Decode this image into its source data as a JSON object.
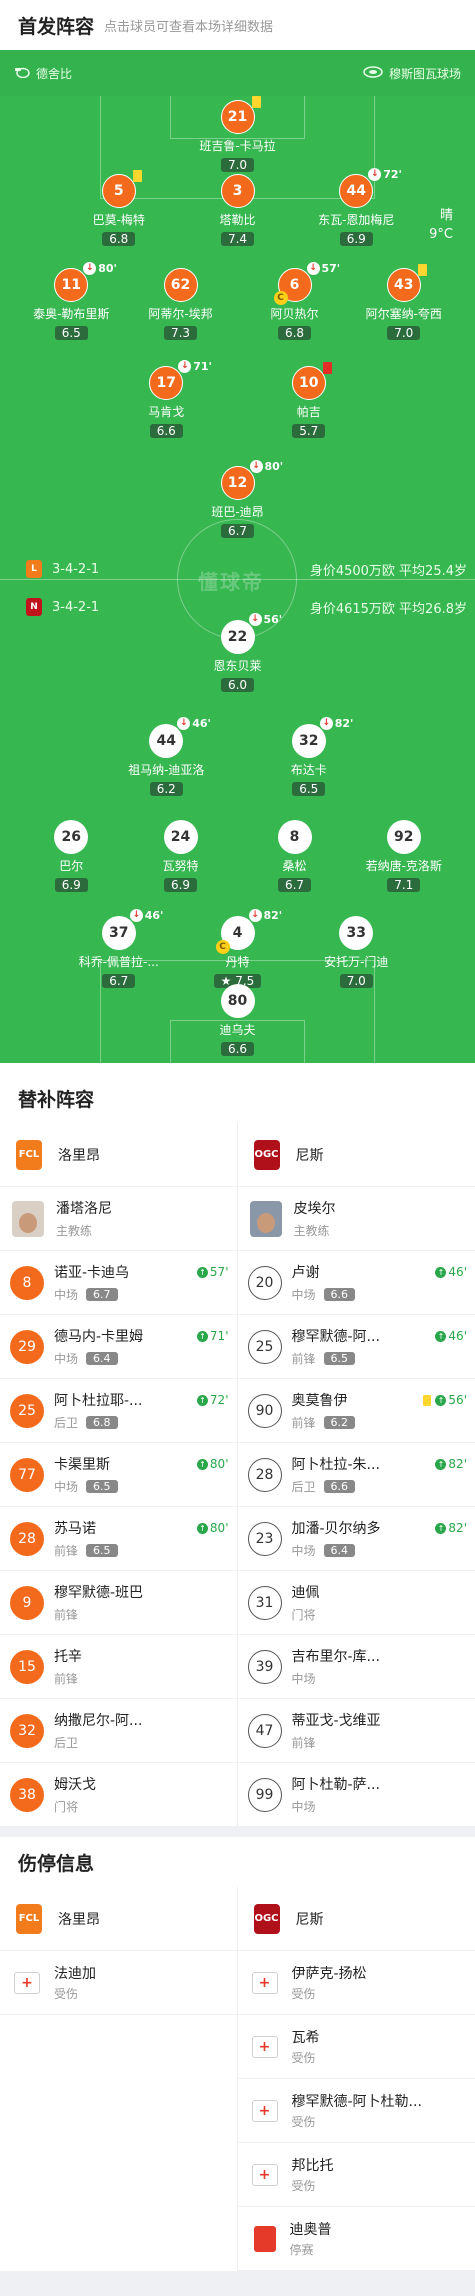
{
  "lineup_section": {
    "title": "首发阵容",
    "subtitle": "点击球员可查看本场详细数据"
  },
  "venue": {
    "home_stadium": "德舍比",
    "away_stadium": "穆斯图瓦球场"
  },
  "weather": {
    "condition": "晴",
    "temperature": "9°C"
  },
  "watermark": "懂球帝",
  "home_team": {
    "formation": "3-4-2-1",
    "value_text": "身价4500万欧 平均25.4岁"
  },
  "away_team": {
    "formation": "3-4-2-1",
    "value_text": "身价4615万欧 平均26.8岁"
  },
  "home_players": [
    {
      "num": "21",
      "name": "班吉鲁-卡马拉",
      "rating": "7.0"
    },
    {
      "num": "5",
      "name": "巴莫-梅特",
      "rating": "6.8"
    },
    {
      "num": "3",
      "name": "塔勒比",
      "rating": "7.4"
    },
    {
      "num": "44",
      "name": "东瓦-恩加梅尼",
      "rating": "6.9",
      "event": "72'"
    },
    {
      "num": "11",
      "name": "泰奥-勒布里斯",
      "rating": "6.5",
      "event": "80'"
    },
    {
      "num": "62",
      "name": "阿蒂尔-埃邦",
      "rating": "7.3"
    },
    {
      "num": "6",
      "name": "阿贝热尔",
      "rating": "6.8",
      "event": "57'"
    },
    {
      "num": "43",
      "name": "阿尔塞纳-夸西",
      "rating": "7.0"
    },
    {
      "num": "17",
      "name": "马肯戈",
      "rating": "6.6",
      "event": "71'"
    },
    {
      "num": "10",
      "name": "帕吉",
      "rating": "5.7"
    },
    {
      "num": "12",
      "name": "班巴-迪昂",
      "rating": "6.7",
      "event": "80'"
    }
  ],
  "away_players": [
    {
      "num": "22",
      "name": "恩东贝莱",
      "rating": "6.0",
      "event": "56'"
    },
    {
      "num": "44",
      "name": "祖马纳-迪亚洛",
      "rating": "6.2",
      "event": "46'"
    },
    {
      "num": "32",
      "name": "布达卡",
      "rating": "6.5",
      "event": "82'"
    },
    {
      "num": "26",
      "name": "巴尔",
      "rating": "6.9"
    },
    {
      "num": "24",
      "name": "瓦努特",
      "rating": "6.9"
    },
    {
      "num": "8",
      "name": "桑松",
      "rating": "6.7"
    },
    {
      "num": "92",
      "name": "若纳唐-克洛斯",
      "rating": "7.1"
    },
    {
      "num": "37",
      "name": "科乔-佩普拉-...",
      "rating": "6.7",
      "event": "46'"
    },
    {
      "num": "4",
      "name": "丹特",
      "rating": "7.5",
      "event": "82'"
    },
    {
      "num": "33",
      "name": "安托万-门迪",
      "rating": "7.0"
    },
    {
      "num": "80",
      "name": "迪乌夫",
      "rating": "6.6"
    }
  ],
  "subs_section": {
    "title": "替补阵容"
  },
  "home_team_name": "洛里昂",
  "away_team_name": "尼斯",
  "home_coach": {
    "name": "潘塔洛尼",
    "role": "主教练"
  },
  "away_coach": {
    "name": "皮埃尔",
    "role": "主教练"
  },
  "home_subs": [
    {
      "num": "8",
      "name": "诺亚-卡迪乌",
      "pos": "中场",
      "rating": "6.7",
      "minute": "57'"
    },
    {
      "num": "29",
      "name": "德马内-卡里姆",
      "pos": "中场",
      "rating": "6.4",
      "minute": "71'"
    },
    {
      "num": "25",
      "name": "阿卜杜拉耶-...",
      "pos": "后卫",
      "rating": "6.8",
      "minute": "72'"
    },
    {
      "num": "77",
      "name": "卡渠里斯",
      "pos": "中场",
      "rating": "6.5",
      "minute": "80'"
    },
    {
      "num": "28",
      "name": "苏马诺",
      "pos": "前锋",
      "rating": "6.5",
      "minute": "80'"
    },
    {
      "num": "9",
      "name": "穆罕默德-班巴",
      "pos": "前锋"
    },
    {
      "num": "15",
      "name": "托辛",
      "pos": "前锋"
    },
    {
      "num": "32",
      "name": "纳撒尼尔-阿...",
      "pos": "后卫"
    },
    {
      "num": "38",
      "name": "姆沃戈",
      "pos": "门将"
    }
  ],
  "away_subs": [
    {
      "num": "20",
      "name": "卢谢",
      "pos": "中场",
      "rating": "6.6",
      "minute": "46'"
    },
    {
      "num": "25",
      "name": "穆罕默德-阿...",
      "pos": "前锋",
      "rating": "6.5",
      "minute": "46'"
    },
    {
      "num": "90",
      "name": "奥莫鲁伊",
      "pos": "前锋",
      "rating": "6.2",
      "minute": "56'"
    },
    {
      "num": "28",
      "name": "阿卜杜拉-朱...",
      "pos": "后卫",
      "rating": "6.6",
      "minute": "82'"
    },
    {
      "num": "23",
      "name": "加潘-贝尔纳多",
      "pos": "中场",
      "rating": "6.4",
      "minute": "82'"
    },
    {
      "num": "31",
      "name": "迪佩",
      "pos": "门将"
    },
    {
      "num": "39",
      "name": "吉布里尔-库...",
      "pos": "中场"
    },
    {
      "num": "47",
      "name": "蒂亚戈-戈维亚",
      "pos": "前锋"
    },
    {
      "num": "99",
      "name": "阿卜杜勒-萨...",
      "pos": "中场"
    }
  ],
  "injury_section": {
    "title": "伤停信息"
  },
  "home_injuries": [
    {
      "name": "法迪加",
      "status": "受伤"
    }
  ],
  "away_injuries": [
    {
      "name": "伊萨克-扬松",
      "status": "受伤"
    },
    {
      "name": "瓦希",
      "status": "受伤"
    },
    {
      "name": "穆罕默德-阿卜杜勒...",
      "status": "受伤"
    },
    {
      "name": "邦比托",
      "status": "受伤"
    },
    {
      "name": "迪奥普",
      "status": "停赛"
    }
  ],
  "colors": {
    "pitch": "#36b750",
    "home": "#f46a1c",
    "away": "#ffffff"
  }
}
